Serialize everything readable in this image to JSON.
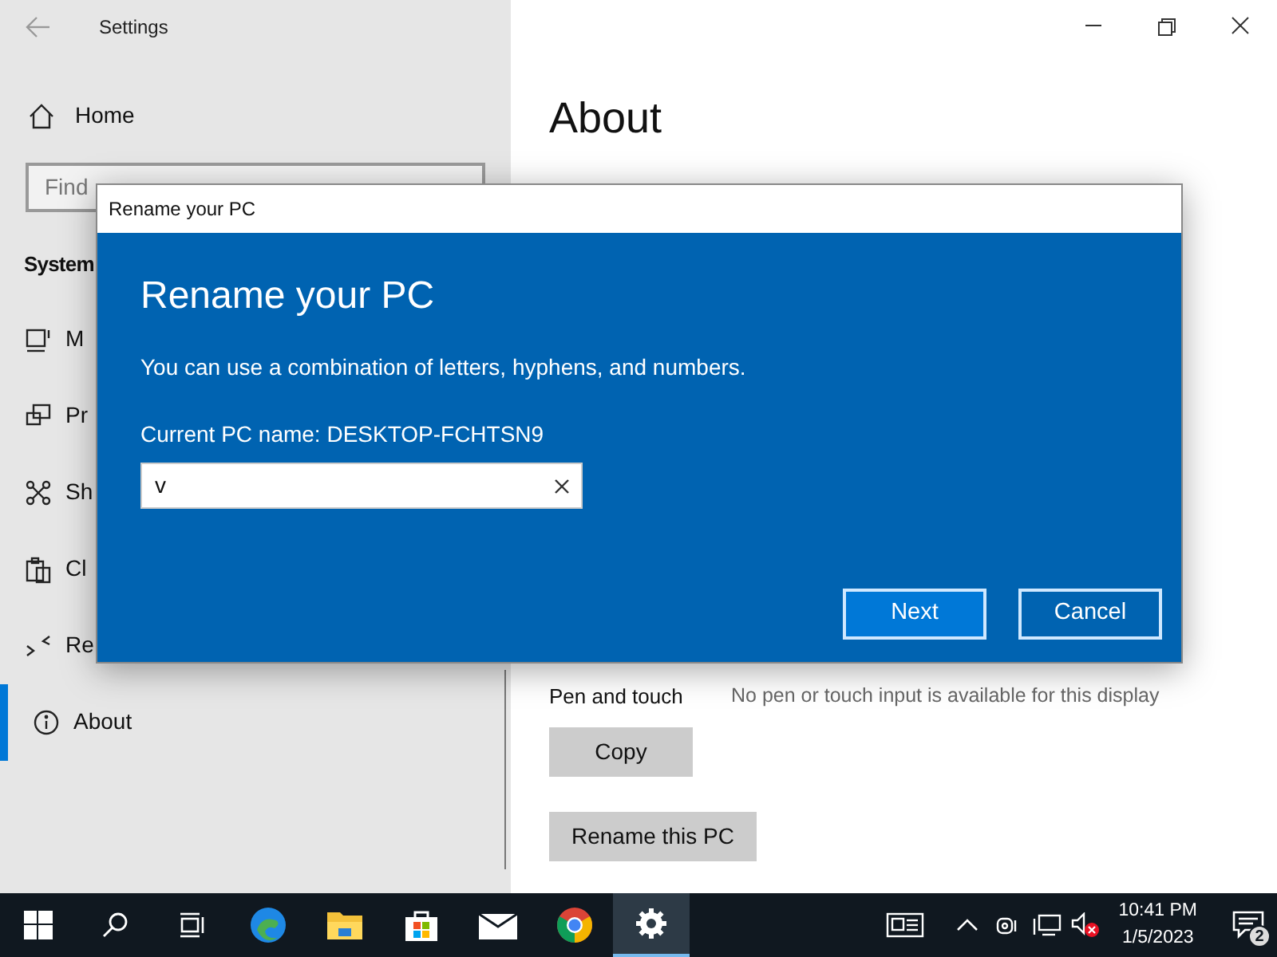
{
  "window": {
    "title": "Settings"
  },
  "sidebar": {
    "home": "Home",
    "search": {
      "placeholder": "Find"
    },
    "section": "System",
    "items": [
      {
        "kind": "display",
        "label": "M",
        "selected": false
      },
      {
        "kind": "project",
        "label": "Pr",
        "selected": false
      },
      {
        "kind": "share",
        "label": "Sh",
        "selected": false
      },
      {
        "kind": "clipboard",
        "label": "Cl",
        "selected": false
      },
      {
        "kind": "remote",
        "label": "Re",
        "selected": false
      },
      {
        "kind": "about",
        "label": "About",
        "selected": true
      }
    ]
  },
  "content": {
    "heading": "About",
    "spec_rows": [
      {
        "label": "Pen and touch",
        "value": "No pen or touch input is available for this display"
      }
    ],
    "buttons": [
      "Copy",
      "Rename this PC"
    ]
  },
  "dialog": {
    "title": "Rename your PC",
    "heading": "Rename your PC",
    "description": "You can use a combination of letters, hyphens, and numbers.",
    "current_name": "Current PC name: DESKTOP-FCHTSN9",
    "input": {
      "value": "v"
    },
    "buttons": [
      {
        "label": "Next",
        "kind": "primary"
      },
      {
        "label": "Cancel",
        "kind": "secondary"
      }
    ]
  },
  "taskbar": {
    "apps": [
      {
        "kind": "start",
        "active": false
      },
      {
        "kind": "search",
        "active": false
      },
      {
        "kind": "taskview",
        "active": false
      },
      {
        "kind": "edge",
        "active": false
      },
      {
        "kind": "explorer",
        "active": false
      },
      {
        "kind": "store",
        "active": false
      },
      {
        "kind": "mail",
        "active": false
      },
      {
        "kind": "chrome",
        "active": false
      },
      {
        "kind": "settings",
        "active": true
      }
    ],
    "time": "10:41 PM",
    "date": "1/5/2023",
    "notification_count": "2"
  }
}
